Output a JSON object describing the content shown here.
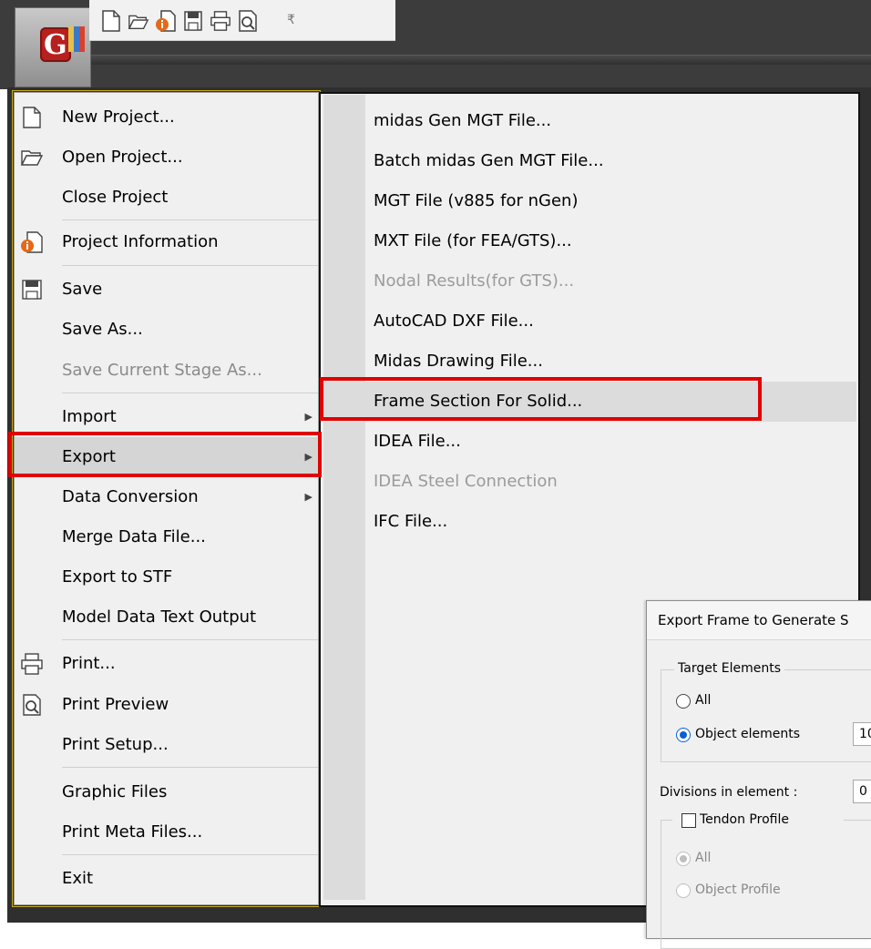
{
  "toolbar": {
    "quick_access": [
      "new-file-icon",
      "open-folder-icon",
      "project-info-icon",
      "save-icon",
      "print-icon",
      "print-preview-icon"
    ],
    "customize": "₹"
  },
  "app_menu": {
    "items": [
      {
        "label": "New Project...",
        "icon": "new-file-icon"
      },
      {
        "label": "Open Project...",
        "icon": "open-folder-icon"
      },
      {
        "label": "Close Project"
      },
      {
        "label": "Project Information",
        "icon": "project-info-icon"
      },
      {
        "label": "Save",
        "icon": "save-icon"
      },
      {
        "label": "Save As..."
      },
      {
        "label": "Save Current Stage As..."
      },
      {
        "label": "Import"
      },
      {
        "label": "Export"
      },
      {
        "label": "Data Conversion"
      },
      {
        "label": "Merge Data File..."
      },
      {
        "label": "Export to STF"
      },
      {
        "label": "Model Data Text Output"
      },
      {
        "label": "Print...",
        "icon": "print-icon"
      },
      {
        "label": "Print Preview",
        "icon": "print-preview-icon"
      },
      {
        "label": "Print Setup..."
      },
      {
        "label": "Graphic Files"
      },
      {
        "label": "Print Meta Files..."
      },
      {
        "label": "Exit"
      }
    ]
  },
  "export_submenu": {
    "items": [
      {
        "label": "midas Gen MGT File..."
      },
      {
        "label": "Batch midas Gen MGT File..."
      },
      {
        "label": "MGT File (v885 for nGen)"
      },
      {
        "label": "MXT File (for FEA/GTS)..."
      },
      {
        "label": "Nodal Results(for GTS)...",
        "disabled": true
      },
      {
        "label": "AutoCAD DXF File..."
      },
      {
        "label": "Midas Drawing File..."
      },
      {
        "label": "Frame Section For Solid..."
      },
      {
        "label": "IDEA File..."
      },
      {
        "label": "IDEA Steel Connection",
        "disabled": true
      },
      {
        "label": "IFC File..."
      }
    ]
  },
  "dialog": {
    "title": "Export Frame to Generate S",
    "target_group": "Target Elements",
    "all_label": "All",
    "object_elements_label": "Object elements",
    "object_elements_value": "10",
    "divisions_label": "Divisions in element :",
    "divisions_value": "0",
    "tendon_profile_label": "Tendon Profile",
    "tendon_all_label": "All",
    "object_profile_label": "Object Profile"
  },
  "colors": {
    "highlight_red": "#e10000",
    "radio_blue": "#0a5fd7",
    "frame_dark": "#2f2f2f"
  }
}
